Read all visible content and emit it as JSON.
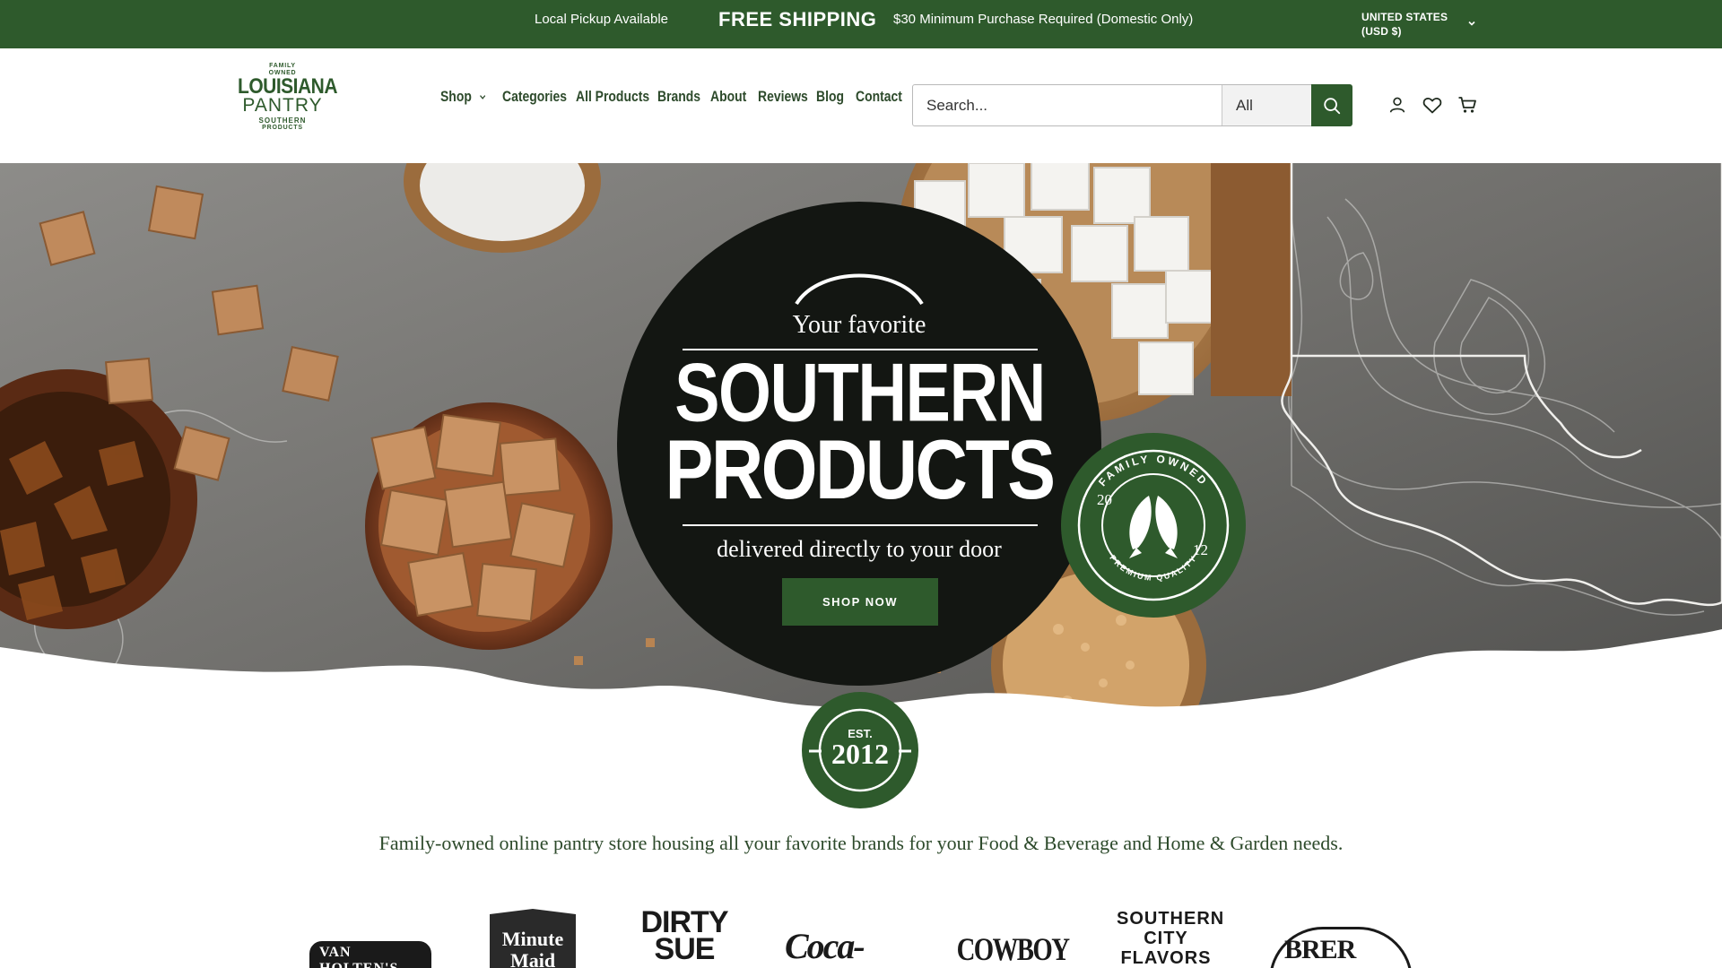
{
  "announcement": {
    "pickup": "Local Pickup Available",
    "free_shipping": "FREE SHIPPING",
    "minimum": "$30 Minimum Purchase Required (Domestic Only)",
    "country_line1": "UNITED STATES",
    "country_line2": "(USD $)"
  },
  "logo": {
    "family": "FAMILY",
    "owned": "OWNED",
    "line1": "LOUISIANA",
    "line2": "PANTRY",
    "southern": "SOUTHERN",
    "products": "PRODUCTS"
  },
  "nav": {
    "items": [
      "Shop",
      "Categories",
      "All Products",
      "Brands",
      "About",
      "Reviews",
      "Blog",
      "Contact"
    ]
  },
  "search": {
    "placeholder": "Search...",
    "category": "All"
  },
  "hero": {
    "your_favorite": "Your favorite",
    "southern": "SOUTHERN",
    "products": "PRODUCTS",
    "delivered": "delivered directly to your door",
    "cta": "SHOP NOW",
    "seal_top": "FAMILY OWNED",
    "seal_bottom": "PREMIUM QUALITY",
    "seal_left": "20",
    "seal_right": "12",
    "est_label": "EST.",
    "est_year": "2012"
  },
  "tagline": "Family-owned online pantry store housing all your favorite brands for your Food & Beverage and Home & Garden needs.",
  "brands": [
    "VAN HOLTEN'S",
    "Minute Maid",
    "DIRTY SUE",
    "Coca-Cola",
    "COWBOY",
    "SOUTHERN CITY FLAVORS",
    "BRER RABBIT"
  ],
  "colors": {
    "brand_green": "#2e5a2c",
    "badge_black": "#131612",
    "text_green": "#2d4a2b"
  }
}
